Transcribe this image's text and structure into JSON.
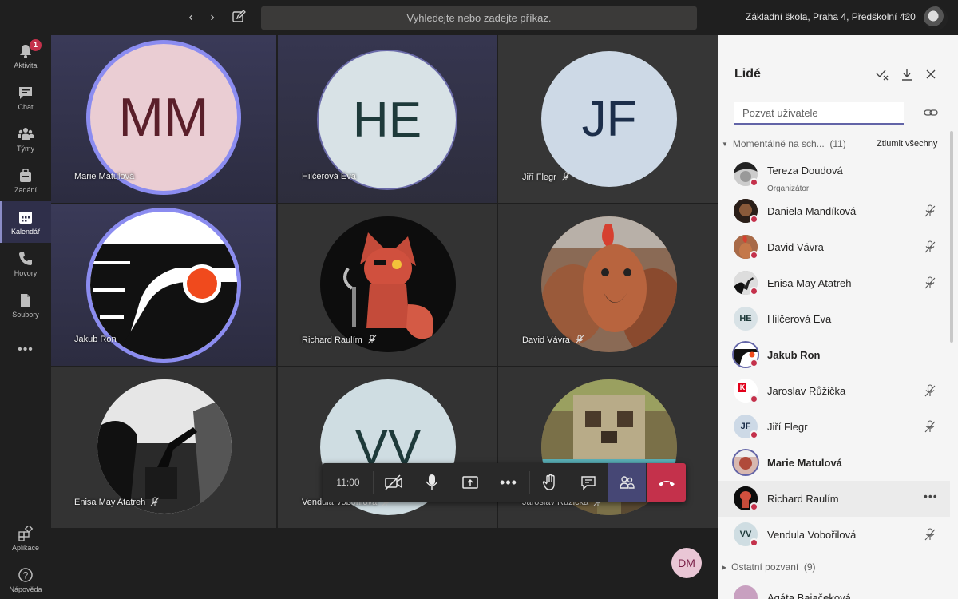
{
  "titlebar": {
    "search_placeholder": "Vyhledejte nebo zadejte příkaz.",
    "org_name": "Základní škola, Praha 4, Předškolní 420"
  },
  "rail": {
    "items": [
      {
        "label": "Aktivita",
        "icon": "bell-icon",
        "badge": "1"
      },
      {
        "label": "Chat",
        "icon": "chat-icon"
      },
      {
        "label": "Týmy",
        "icon": "teams-icon"
      },
      {
        "label": "Zadání",
        "icon": "assignments-icon"
      },
      {
        "label": "Kalendář",
        "icon": "calendar-icon",
        "active": true
      },
      {
        "label": "Hovory",
        "icon": "phone-icon"
      },
      {
        "label": "Soubory",
        "icon": "files-icon"
      },
      {
        "label": "Aplikace",
        "icon": "apps-icon"
      },
      {
        "label": "Nápověda",
        "icon": "help-icon"
      }
    ]
  },
  "stage": {
    "tiles": [
      {
        "name": "Marie Matulová",
        "initials": "MM",
        "muted": false
      },
      {
        "name": "Hilčerová Eva",
        "initials": "HE",
        "muted": false
      },
      {
        "name": "Jiří Flegr",
        "initials": "JF",
        "muted": true
      },
      {
        "name": "Jakub Ron",
        "muted": false
      },
      {
        "name": "Richard Raulím",
        "muted": true
      },
      {
        "name": "David Vávra",
        "muted": true
      },
      {
        "name": "Enisa May Atatreh",
        "muted": true
      },
      {
        "name": "Vendula Vobořilová",
        "initials": "VV",
        "muted": true
      },
      {
        "name": "Jaroslav Růžička",
        "muted": true
      }
    ],
    "call_time": "11:00",
    "self_initials": "DM"
  },
  "panel": {
    "title": "Lidé",
    "invite_placeholder": "Pozvat uživatele",
    "current_section": "Momentálně na sch...",
    "current_count": "(11)",
    "mute_all": "Ztlumit všechny",
    "people": [
      {
        "name": "Tereza Doudová",
        "role": "Organizátor",
        "muted": false
      },
      {
        "name": "Daniela Mandíková",
        "muted": true
      },
      {
        "name": "David Vávra",
        "muted": true
      },
      {
        "name": "Enisa May Atatreh",
        "muted": true
      },
      {
        "name": "Hilčerová Eva",
        "initials": "HE",
        "muted": false
      },
      {
        "name": "Jakub Ron",
        "muted": false,
        "bold": true
      },
      {
        "name": "Jaroslav Růžička",
        "muted": true
      },
      {
        "name": "Jiří Flegr",
        "initials": "JF",
        "muted": true
      },
      {
        "name": "Marie Matulová",
        "muted": false,
        "bold": true
      },
      {
        "name": "Richard Raulím",
        "muted": false
      },
      {
        "name": "Vendula Vobořilová",
        "initials": "VV",
        "muted": true
      },
      {
        "name": "Agáta Bajačeková"
      }
    ],
    "other_section": "Ostatní pozvaní",
    "other_count": "(9)"
  },
  "colors": {
    "accent": "#6264a7",
    "hangup": "#c4314b",
    "speaking_ring": "#8b8cf0"
  }
}
